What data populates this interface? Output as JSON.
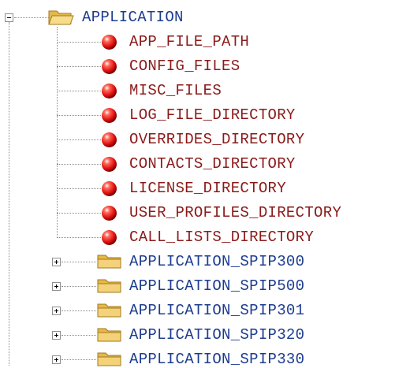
{
  "root": {
    "label": "APPLICATION",
    "expanded": true,
    "icon": "folder-open-icon"
  },
  "leaves": [
    {
      "label": "APP_FILE_PATH",
      "icon": "red-ball-icon"
    },
    {
      "label": "CONFIG_FILES",
      "icon": "red-ball-icon"
    },
    {
      "label": "MISC_FILES",
      "icon": "red-ball-icon"
    },
    {
      "label": "LOG_FILE_DIRECTORY",
      "icon": "red-ball-icon"
    },
    {
      "label": "OVERRIDES_DIRECTORY",
      "icon": "red-ball-icon"
    },
    {
      "label": "CONTACTS_DIRECTORY",
      "icon": "red-ball-icon"
    },
    {
      "label": "LICENSE_DIRECTORY",
      "icon": "red-ball-icon"
    },
    {
      "label": "USER_PROFILES_DIRECTORY",
      "icon": "red-ball-icon"
    },
    {
      "label": "CALL_LISTS_DIRECTORY",
      "icon": "red-ball-icon"
    }
  ],
  "subfolders": [
    {
      "label": "APPLICATION_SPIP300",
      "expanded": false,
      "icon": "folder-icon"
    },
    {
      "label": "APPLICATION_SPIP500",
      "expanded": false,
      "icon": "folder-icon"
    },
    {
      "label": "APPLICATION_SPIP301",
      "expanded": false,
      "icon": "folder-icon"
    },
    {
      "label": "APPLICATION_SPIP320",
      "expanded": false,
      "icon": "folder-icon"
    },
    {
      "label": "APPLICATION_SPIP330",
      "expanded": false,
      "icon": "folder-icon"
    }
  ],
  "colors": {
    "folder_text": "#1c3c8f",
    "leaf_text": "#8b1a1a",
    "connector": "#8a8a8a",
    "folder_fill": "#f3d27a",
    "ball_red": "#e01010"
  }
}
